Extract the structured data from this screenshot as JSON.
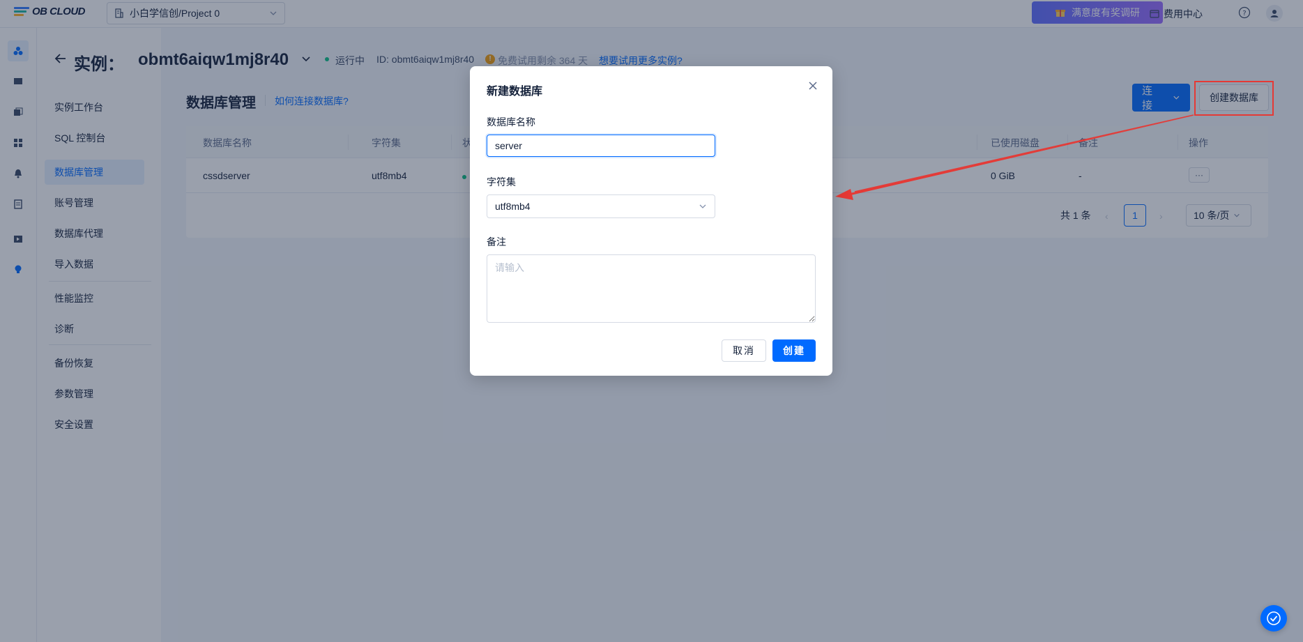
{
  "topbar": {
    "logo_text": "OB CLOUD",
    "project": "小白学信创/Project 0",
    "survey_label": "满意度有奖调研",
    "billing_label": "费用中心"
  },
  "subnav": {
    "items": [
      "实例工作台",
      "SQL 控制台",
      "数据库管理",
      "账号管理",
      "数据库代理",
      "导入数据",
      "性能监控",
      "诊断",
      "备份恢复",
      "参数管理",
      "安全设置"
    ],
    "active": "数据库管理"
  },
  "instance": {
    "title_label": "实例：",
    "name": "obmt6aiqw1mj8r40",
    "status": "运行中",
    "id_text": "ID: obmt6aiqw1mj8r40",
    "trial_text": "免费试用剩余 364 天",
    "trial_link": "想要试用更多实例?"
  },
  "page": {
    "title": "数据库管理",
    "help_link": "如何连接数据库?",
    "connect_label": "连 接",
    "create_db_label": "创建数据库"
  },
  "table": {
    "headers": [
      "数据库名称",
      "字符集",
      "状",
      "已使用磁盘",
      "备注",
      "操作"
    ],
    "rows": [
      {
        "name": "cssdserver",
        "charset": "utf8mb4",
        "disk": "0 GiB",
        "remark": "-",
        "action": "···"
      }
    ],
    "pager": {
      "total": "共 1 条",
      "prev": "‹",
      "page": "1",
      "next": "›",
      "page_size": "10 条/页"
    }
  },
  "modal": {
    "title": "新建数据库",
    "name_label": "数据库名称",
    "name_value": "server",
    "charset_label": "字符集",
    "charset_value": "utf8mb4",
    "remark_label": "备注",
    "remark_placeholder": "请输入",
    "cancel_label": "取消",
    "create_label": "创建"
  },
  "colors": {
    "primary": "#006aff",
    "status_green": "#0ac185",
    "annotation_red": "#e53935",
    "survey_gradient_start": "#5f6dff",
    "survey_gradient_end": "#9a6cff"
  },
  "icons": [
    "building-icon",
    "chevron-down-icon",
    "gift-icon",
    "billing-icon",
    "help-icon",
    "user-icon",
    "back-arrow-icon",
    "close-icon",
    "check-icon"
  ]
}
